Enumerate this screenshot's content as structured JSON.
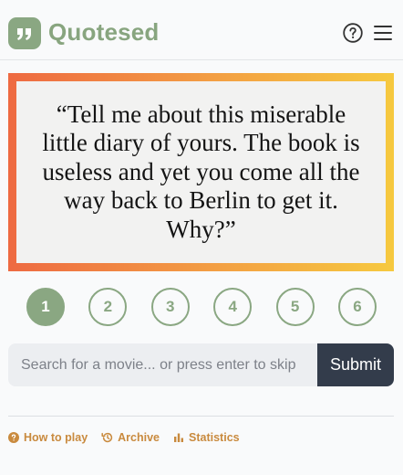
{
  "header": {
    "title": "Quotesed",
    "logo_icon": "quote-marks-icon",
    "help_icon": "question-circle-icon",
    "menu_icon": "hamburger-menu-icon"
  },
  "quote": {
    "text": "“Tell me about this miserable little diary of yours. The book is useless and yet you come all the way back to Berlin to get it. Why?”"
  },
  "guesses": [
    {
      "label": "1",
      "active": true
    },
    {
      "label": "2",
      "active": false
    },
    {
      "label": "3",
      "active": false
    },
    {
      "label": "4",
      "active": false
    },
    {
      "label": "5",
      "active": false
    },
    {
      "label": "6",
      "active": false
    }
  ],
  "search": {
    "placeholder": "Search for a movie... or press enter to skip",
    "value": "",
    "submit_label": "Submit"
  },
  "footer": {
    "how_to_play": "How to play",
    "archive": "Archive",
    "statistics": "Statistics"
  },
  "colors": {
    "brand_green": "#8aa782",
    "footer_link": "#c98a3e",
    "submit_bg": "#333c4b",
    "gradient_start": "#ee6a42",
    "gradient_end": "#f6c93f"
  }
}
